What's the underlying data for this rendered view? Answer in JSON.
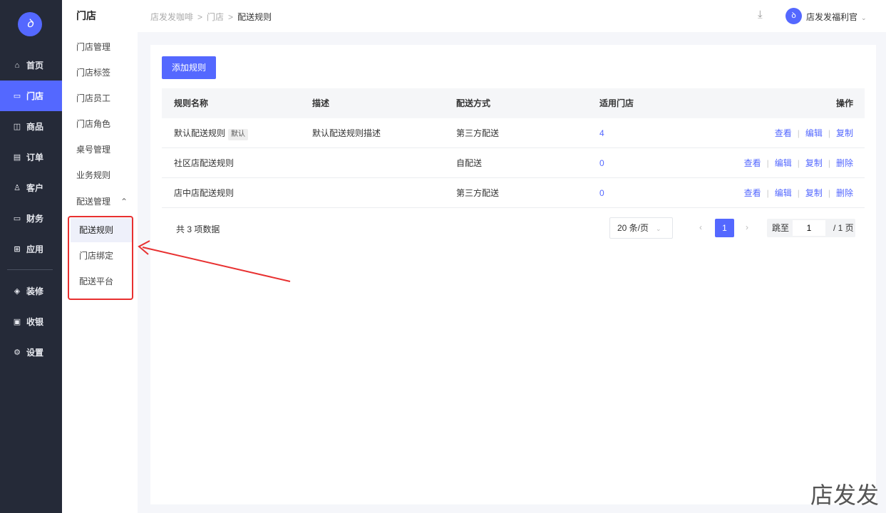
{
  "brand": {
    "logo_text": "ꝺ",
    "accent": "#5468ff"
  },
  "nav": [
    {
      "icon": "home-icon",
      "glyph": "⌂",
      "label": "首页"
    },
    {
      "icon": "store-icon",
      "glyph": "▭",
      "label": "门店"
    },
    {
      "icon": "bag-icon",
      "glyph": "◫",
      "label": "商品"
    },
    {
      "icon": "order-icon",
      "glyph": "▤",
      "label": "订单"
    },
    {
      "icon": "user-icon",
      "glyph": "♙",
      "label": "客户"
    },
    {
      "icon": "wallet-icon",
      "glyph": "▭",
      "label": "财务"
    },
    {
      "icon": "apps-icon",
      "glyph": "⊞",
      "label": "应用"
    },
    {
      "icon": "layers-icon",
      "glyph": "◈",
      "label": "装修"
    },
    {
      "icon": "cashier-icon",
      "glyph": "▣",
      "label": "收银"
    },
    {
      "icon": "gear-icon",
      "glyph": "⚙",
      "label": "设置"
    }
  ],
  "subnav": {
    "title": "门店",
    "items": [
      "门店管理",
      "门店标签",
      "门店员工",
      "门店角色",
      "桌号管理",
      "业务规则"
    ],
    "group": "配送管理",
    "group_glyph": "⌃",
    "children": [
      "配送规则",
      "门店绑定",
      "配送平台"
    ]
  },
  "header": {
    "breadcrumb": [
      "店发发咖啡",
      "门店",
      "配送规则"
    ],
    "sep": ">",
    "download_glyph": "⤓",
    "user": "店发发福利官",
    "chevron": "⌄"
  },
  "main": {
    "add_button": "添加规则",
    "columns": [
      "规则名称",
      "描述",
      "配送方式",
      "适用门店",
      "操作"
    ],
    "rows": [
      {
        "name": "默认配送规则",
        "tag": "默认",
        "desc": "默认配送规则描述",
        "method": "第三方配送",
        "stores": "4",
        "actions": [
          "查看",
          "编辑",
          "复制"
        ]
      },
      {
        "name": "社区店配送规则",
        "tag": "",
        "desc": "",
        "method": "自配送",
        "stores": "0",
        "actions": [
          "查看",
          "编辑",
          "复制",
          "删除"
        ]
      },
      {
        "name": "店中店配送规则",
        "tag": "",
        "desc": "",
        "method": "第三方配送",
        "stores": "0",
        "actions": [
          "查看",
          "编辑",
          "复制",
          "删除"
        ]
      }
    ],
    "pagination": {
      "total": "共 3 项数据",
      "page_size": "20 条/页",
      "current": "1",
      "jump_label": "跳至",
      "jump_value": "1",
      "of": "/ 1 页",
      "prev": "‹",
      "next": "›"
    }
  },
  "watermark": "店发发"
}
